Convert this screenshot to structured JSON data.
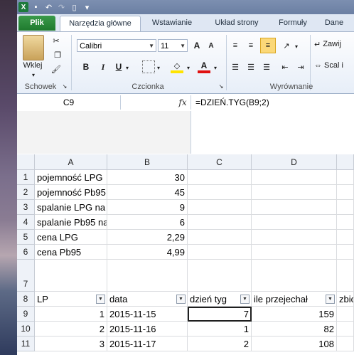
{
  "quick_access": {
    "icons": [
      "excel-icon",
      "save-icon",
      "undo-icon",
      "redo-icon",
      "new-icon",
      "customize-icon"
    ]
  },
  "tabs": [
    "Plik",
    "Narzędzia główne",
    "Wstawianie",
    "Układ strony",
    "Formuły",
    "Dane"
  ],
  "ribbon": {
    "paste_label": "Wklej",
    "clipboard_group": "Schowek",
    "font_group": "Czcionka",
    "font_name": "Calibri",
    "font_size": "11",
    "bold": "B",
    "italic": "I",
    "underline": "U",
    "font_size_up": "A",
    "font_size_down": "A",
    "font_color": "A",
    "alignment_group": "Wyrównanie",
    "wrap_text": "Zawij",
    "merge": "Scal i"
  },
  "formula_bar": {
    "cell_ref": "C9",
    "fx": "fx",
    "formula": "=DZIEŃ.TYG(B9;2)"
  },
  "columns": [
    "A",
    "B",
    "C",
    "D"
  ],
  "rows": [
    {
      "n": "1",
      "a": "pojemność LPG",
      "b": "30",
      "c": "",
      "d": ""
    },
    {
      "n": "2",
      "a": "pojemność Pb95",
      "b": "45",
      "c": "",
      "d": ""
    },
    {
      "n": "3",
      "a": "spalanie LPG na",
      "b": "9",
      "c": "",
      "d": ""
    },
    {
      "n": "4",
      "a": "spalanie Pb95 na",
      "b": "6",
      "c": "",
      "d": ""
    },
    {
      "n": "5",
      "a": "cena LPG",
      "b": "2,29",
      "c": "",
      "d": ""
    },
    {
      "n": "6",
      "a": "cena Pb95",
      "b": "4,99",
      "c": "",
      "d": ""
    },
    {
      "n": "7",
      "a": "",
      "b": "",
      "c": "",
      "d": ""
    },
    {
      "n": "8",
      "a": "LP",
      "b": "data",
      "c": "dzień tyg",
      "d": "ile przejechał",
      "e": "zbio"
    },
    {
      "n": "9",
      "a": "1",
      "b": "2015-11-15",
      "c": "7",
      "d": "159"
    },
    {
      "n": "10",
      "a": "2",
      "b": "2015-11-16",
      "c": "1",
      "d": "82"
    },
    {
      "n": "11",
      "a": "3",
      "b": "2015-11-17",
      "c": "2",
      "d": "108"
    }
  ]
}
